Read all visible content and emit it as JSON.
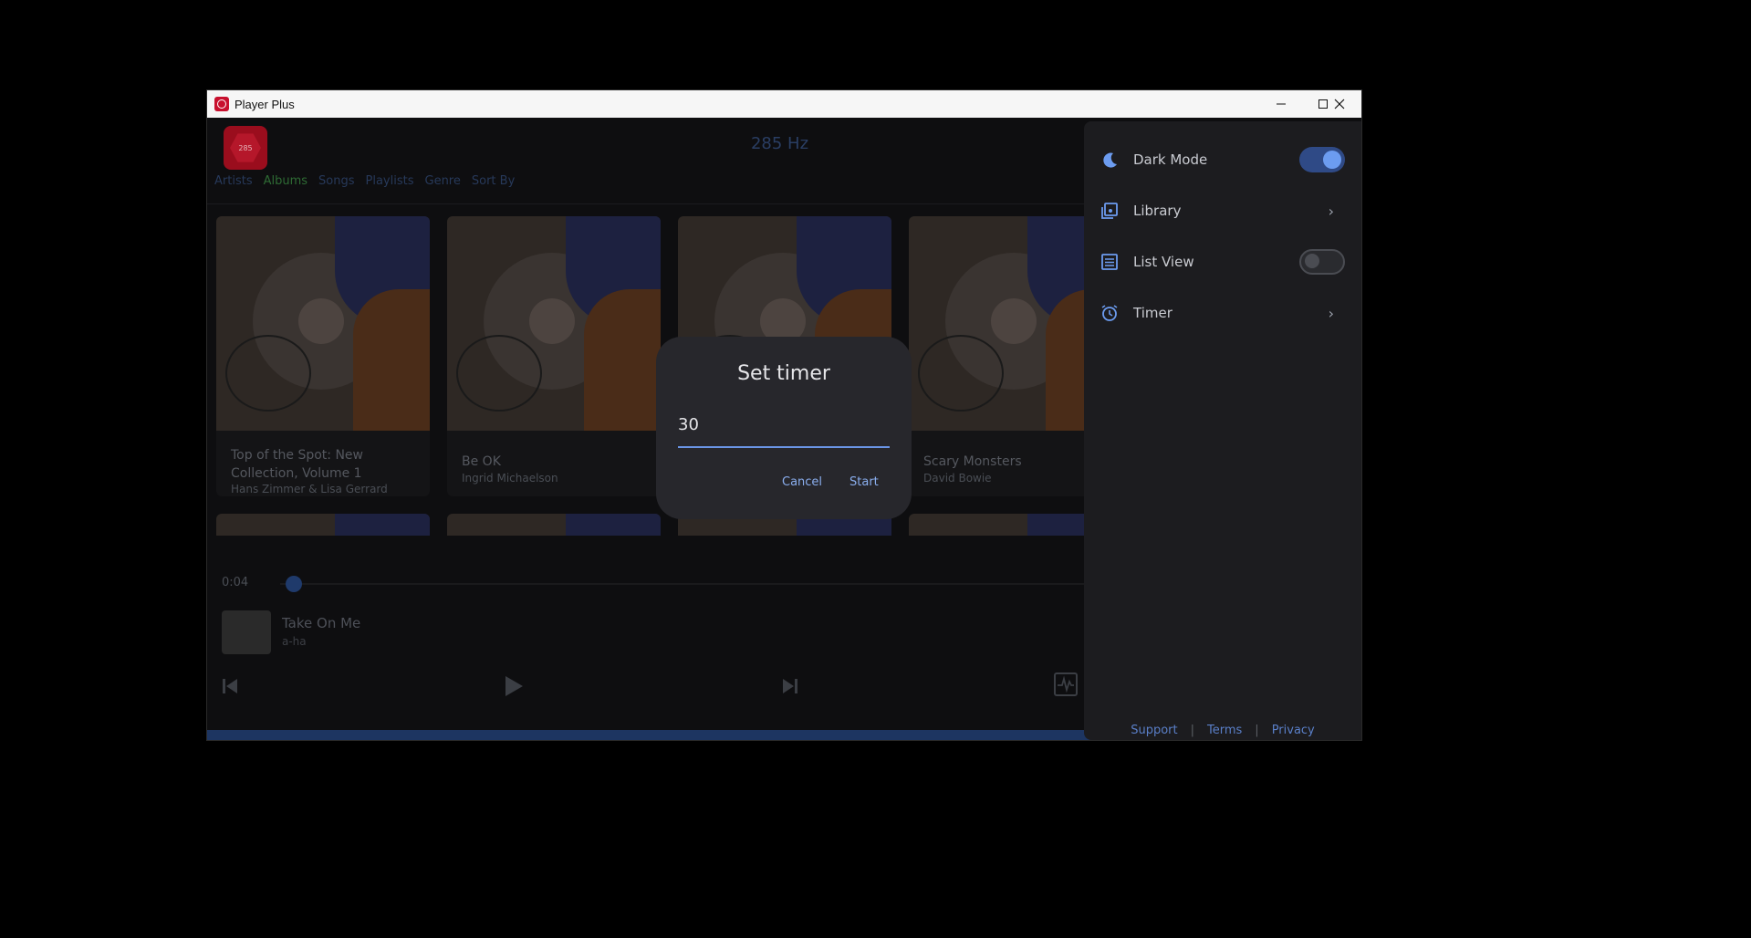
{
  "window": {
    "title": "Player Plus"
  },
  "header": {
    "logo_text": "285",
    "hz_label": "285 Hz"
  },
  "nav": [
    "Artists",
    "Albums",
    "Songs",
    "Playlists",
    "Genre",
    "Sort By"
  ],
  "albums": [
    {
      "title": "Top of the Spot: New Collection, Volume 1",
      "artist": "Hans Zimmer & Lisa Gerrard"
    },
    {
      "title": "Be OK",
      "artist": "Ingrid Michaelson"
    },
    {
      "title": "",
      "artist": ""
    },
    {
      "title": "Scary Monsters",
      "artist": "David Bowie"
    }
  ],
  "player": {
    "elapsed": "0:04",
    "progress": 0.02,
    "track_title": "Take On Me",
    "track_artist": "a-ha"
  },
  "drawer": {
    "items": [
      {
        "label": "Dark Mode",
        "icon": "moon-icon",
        "control": "toggle",
        "on": true
      },
      {
        "label": "Library",
        "icon": "library-icon",
        "control": "chevron"
      },
      {
        "label": "List View",
        "icon": "list-icon",
        "control": "toggle",
        "on": false
      },
      {
        "label": "Timer",
        "icon": "alarm-icon",
        "control": "chevron"
      }
    ],
    "footer": [
      "Support",
      "Terms",
      "Privacy"
    ]
  },
  "dialog": {
    "title": "Set timer",
    "value": "30",
    "cancel_label": "Cancel",
    "start_label": "Start"
  },
  "colors": {
    "accent": "#6c9cf0",
    "toggle_on": "#2f4a86",
    "nav_active": "#2e6b34"
  }
}
